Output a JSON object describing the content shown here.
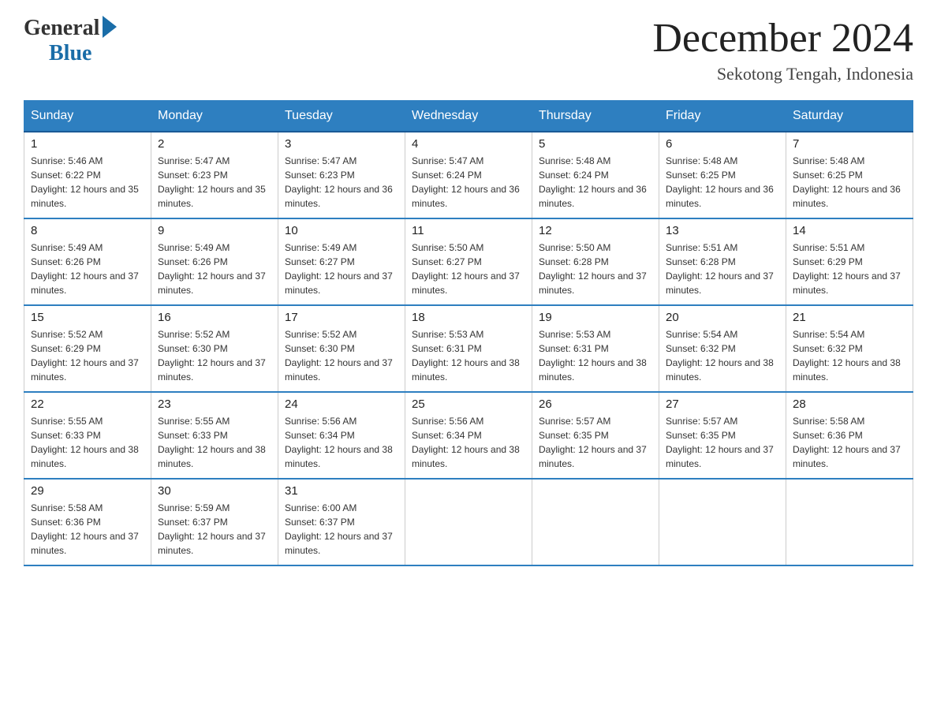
{
  "header": {
    "logo_general": "General",
    "logo_blue": "Blue",
    "month_title": "December 2024",
    "location": "Sekotong Tengah, Indonesia"
  },
  "days_of_week": [
    "Sunday",
    "Monday",
    "Tuesday",
    "Wednesday",
    "Thursday",
    "Friday",
    "Saturday"
  ],
  "weeks": [
    [
      {
        "day": "1",
        "sunrise": "5:46 AM",
        "sunset": "6:22 PM",
        "daylight": "12 hours and 35 minutes."
      },
      {
        "day": "2",
        "sunrise": "5:47 AM",
        "sunset": "6:23 PM",
        "daylight": "12 hours and 35 minutes."
      },
      {
        "day": "3",
        "sunrise": "5:47 AM",
        "sunset": "6:23 PM",
        "daylight": "12 hours and 36 minutes."
      },
      {
        "day": "4",
        "sunrise": "5:47 AM",
        "sunset": "6:24 PM",
        "daylight": "12 hours and 36 minutes."
      },
      {
        "day": "5",
        "sunrise": "5:48 AM",
        "sunset": "6:24 PM",
        "daylight": "12 hours and 36 minutes."
      },
      {
        "day": "6",
        "sunrise": "5:48 AM",
        "sunset": "6:25 PM",
        "daylight": "12 hours and 36 minutes."
      },
      {
        "day": "7",
        "sunrise": "5:48 AM",
        "sunset": "6:25 PM",
        "daylight": "12 hours and 36 minutes."
      }
    ],
    [
      {
        "day": "8",
        "sunrise": "5:49 AM",
        "sunset": "6:26 PM",
        "daylight": "12 hours and 37 minutes."
      },
      {
        "day": "9",
        "sunrise": "5:49 AM",
        "sunset": "6:26 PM",
        "daylight": "12 hours and 37 minutes."
      },
      {
        "day": "10",
        "sunrise": "5:49 AM",
        "sunset": "6:27 PM",
        "daylight": "12 hours and 37 minutes."
      },
      {
        "day": "11",
        "sunrise": "5:50 AM",
        "sunset": "6:27 PM",
        "daylight": "12 hours and 37 minutes."
      },
      {
        "day": "12",
        "sunrise": "5:50 AM",
        "sunset": "6:28 PM",
        "daylight": "12 hours and 37 minutes."
      },
      {
        "day": "13",
        "sunrise": "5:51 AM",
        "sunset": "6:28 PM",
        "daylight": "12 hours and 37 minutes."
      },
      {
        "day": "14",
        "sunrise": "5:51 AM",
        "sunset": "6:29 PM",
        "daylight": "12 hours and 37 minutes."
      }
    ],
    [
      {
        "day": "15",
        "sunrise": "5:52 AM",
        "sunset": "6:29 PM",
        "daylight": "12 hours and 37 minutes."
      },
      {
        "day": "16",
        "sunrise": "5:52 AM",
        "sunset": "6:30 PM",
        "daylight": "12 hours and 37 minutes."
      },
      {
        "day": "17",
        "sunrise": "5:52 AM",
        "sunset": "6:30 PM",
        "daylight": "12 hours and 37 minutes."
      },
      {
        "day": "18",
        "sunrise": "5:53 AM",
        "sunset": "6:31 PM",
        "daylight": "12 hours and 38 minutes."
      },
      {
        "day": "19",
        "sunrise": "5:53 AM",
        "sunset": "6:31 PM",
        "daylight": "12 hours and 38 minutes."
      },
      {
        "day": "20",
        "sunrise": "5:54 AM",
        "sunset": "6:32 PM",
        "daylight": "12 hours and 38 minutes."
      },
      {
        "day": "21",
        "sunrise": "5:54 AM",
        "sunset": "6:32 PM",
        "daylight": "12 hours and 38 minutes."
      }
    ],
    [
      {
        "day": "22",
        "sunrise": "5:55 AM",
        "sunset": "6:33 PM",
        "daylight": "12 hours and 38 minutes."
      },
      {
        "day": "23",
        "sunrise": "5:55 AM",
        "sunset": "6:33 PM",
        "daylight": "12 hours and 38 minutes."
      },
      {
        "day": "24",
        "sunrise": "5:56 AM",
        "sunset": "6:34 PM",
        "daylight": "12 hours and 38 minutes."
      },
      {
        "day": "25",
        "sunrise": "5:56 AM",
        "sunset": "6:34 PM",
        "daylight": "12 hours and 38 minutes."
      },
      {
        "day": "26",
        "sunrise": "5:57 AM",
        "sunset": "6:35 PM",
        "daylight": "12 hours and 37 minutes."
      },
      {
        "day": "27",
        "sunrise": "5:57 AM",
        "sunset": "6:35 PM",
        "daylight": "12 hours and 37 minutes."
      },
      {
        "day": "28",
        "sunrise": "5:58 AM",
        "sunset": "6:36 PM",
        "daylight": "12 hours and 37 minutes."
      }
    ],
    [
      {
        "day": "29",
        "sunrise": "5:58 AM",
        "sunset": "6:36 PM",
        "daylight": "12 hours and 37 minutes."
      },
      {
        "day": "30",
        "sunrise": "5:59 AM",
        "sunset": "6:37 PM",
        "daylight": "12 hours and 37 minutes."
      },
      {
        "day": "31",
        "sunrise": "6:00 AM",
        "sunset": "6:37 PM",
        "daylight": "12 hours and 37 minutes."
      },
      null,
      null,
      null,
      null
    ]
  ]
}
